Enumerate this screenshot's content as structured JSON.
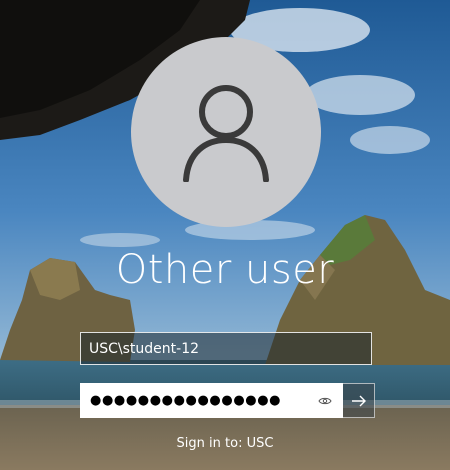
{
  "background": {
    "image": "windows-lockscreen-beach-cave"
  },
  "avatar": {
    "icon": "user-icon",
    "color": "#c9cacd"
  },
  "user": {
    "display_name": "Other user"
  },
  "username_field": {
    "value": "USC\\student-12"
  },
  "password_field": {
    "masked_value": "●●●●●●●●●●●●●●●●",
    "reveal_icon": "eye-icon"
  },
  "submit": {
    "icon": "arrow-right-icon"
  },
  "footer": {
    "sign_in_to": "Sign in to: USC"
  }
}
